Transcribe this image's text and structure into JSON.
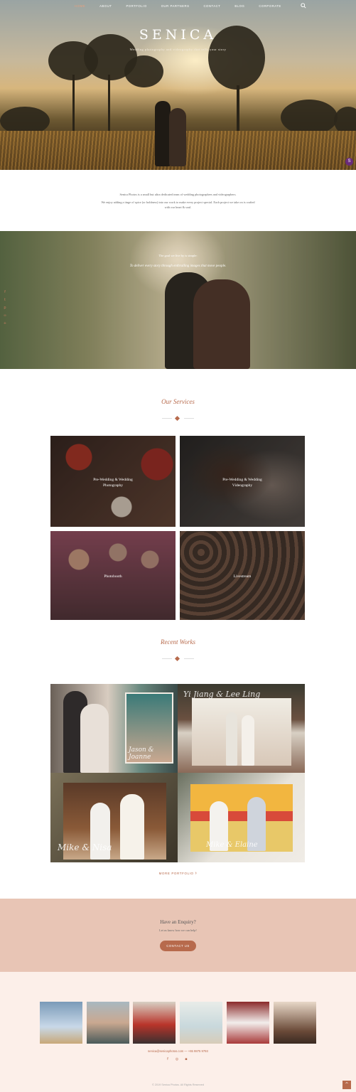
{
  "nav": {
    "items": [
      "HOME",
      "ABOUT",
      "PORTFOLIO",
      "OUR PARTNERS",
      "CONTACT",
      "BLOG",
      "CORPORATE"
    ],
    "active": "HOME"
  },
  "hero": {
    "logo": "SENICA",
    "tagline": "Wedding photography and videography that tells your story",
    "chat_badge": "S"
  },
  "intro": {
    "line1": "Senica Photos is a small but ultra dedicated team of wedding photographers and videographers.",
    "line2": "We enjoy adding a tinge of spice (or boldness) into our work to make every project special. Each project we take on is crafted",
    "line3": "with our heart & soul."
  },
  "mission": {
    "heading": "The goal we live by is simple:",
    "quote": "To deliver every story through enthralling images that move people."
  },
  "services": {
    "title": "Our Services",
    "cards": [
      {
        "line1": "Pre-Wedding & Wedding",
        "line2": "Photography"
      },
      {
        "line1": "Pre-Wedding & Wedding",
        "line2": "Videography"
      },
      {
        "line1": "Photobooth",
        "line2": ""
      },
      {
        "line1": "Livestream",
        "line2": ""
      }
    ]
  },
  "works": {
    "title": "Recent Works",
    "scripts": [
      "Jason & Joanne",
      "Yi Jiang & Lee Ling",
      "Mike & Nisa",
      "Mike & Elaine"
    ],
    "more_label": "MORE PORTFOLIO"
  },
  "enquiry": {
    "title": "Have an Enquiry?",
    "subtitle": "Let us know how we can help!",
    "button": "CONTACT US"
  },
  "footer": {
    "contact": "senica@senicaphotos.com  —  +65 9875 9793",
    "copyright": "© 2019 Senica Photos. All Rights Reserved"
  },
  "colors": {
    "accent": "#b76a4c",
    "enquiry_bg": "#e8c5b5",
    "footer_bg": "#fcefe9"
  },
  "icons": [
    "search-icon",
    "facebook-icon",
    "twitter-icon",
    "pinterest-icon",
    "link-icon",
    "plus-icon",
    "instagram-icon",
    "chat-icon",
    "arrow-up-icon",
    "chevron-right-icon"
  ]
}
